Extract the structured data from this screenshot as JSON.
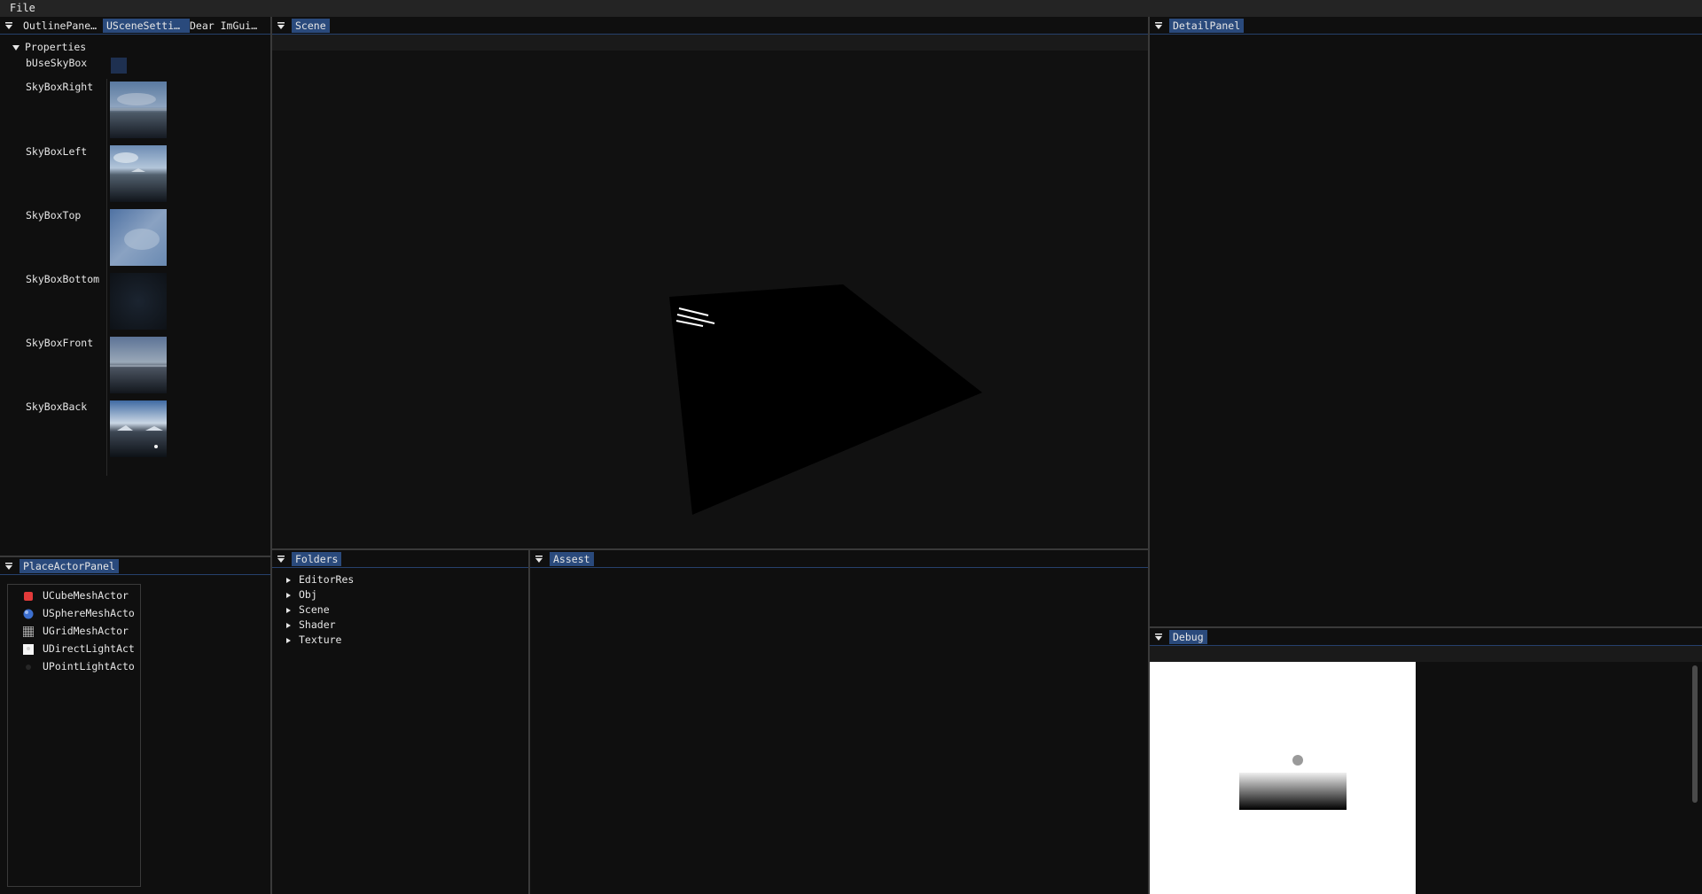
{
  "menubar": {
    "file_label": "File"
  },
  "left_panel": {
    "tabs": [
      {
        "label": "OutlinePane…",
        "active": false
      },
      {
        "label": "USceneSetti…",
        "active": true
      },
      {
        "label": "Dear ImGui…",
        "active": false
      }
    ],
    "properties_header": "Properties",
    "props": {
      "use_skybox_label": "bUseSkyBox",
      "use_skybox_checked": false,
      "skybox_right": "SkyBoxRight",
      "skybox_left": "SkyBoxLeft",
      "skybox_top": "SkyBoxTop",
      "skybox_bottom": "SkyBoxBottom",
      "skybox_front": "SkyBoxFront",
      "skybox_back": "SkyBoxBack"
    }
  },
  "place_actor_panel": {
    "tab_label": "PlaceActorPanel",
    "items": [
      {
        "label": "UCubeMeshActor",
        "icon": "cube-icon"
      },
      {
        "label": "USphereMeshActo",
        "icon": "sphere-icon"
      },
      {
        "label": "UGridMeshActor",
        "icon": "grid-icon"
      },
      {
        "label": "UDirectLightAct",
        "icon": "light-bulb-icon"
      },
      {
        "label": "UPointLightActo",
        "icon": "point-light-icon"
      }
    ]
  },
  "scene_panel": {
    "tab_label": "Scene"
  },
  "folders_panel": {
    "tab_label": "Folders",
    "items": [
      "EditorRes",
      "Obj",
      "Scene",
      "Shader",
      "Texture"
    ]
  },
  "assets_panel": {
    "tab_label": "Assest"
  },
  "detail_panel": {
    "tab_label": "DetailPanel"
  },
  "debug_panel": {
    "tab_label": "Debug"
  },
  "colors": {
    "tab_active": "#2a4a7c",
    "background": "#0f0f0f",
    "menubar": "#242424",
    "separator": "#3a3a3a"
  }
}
